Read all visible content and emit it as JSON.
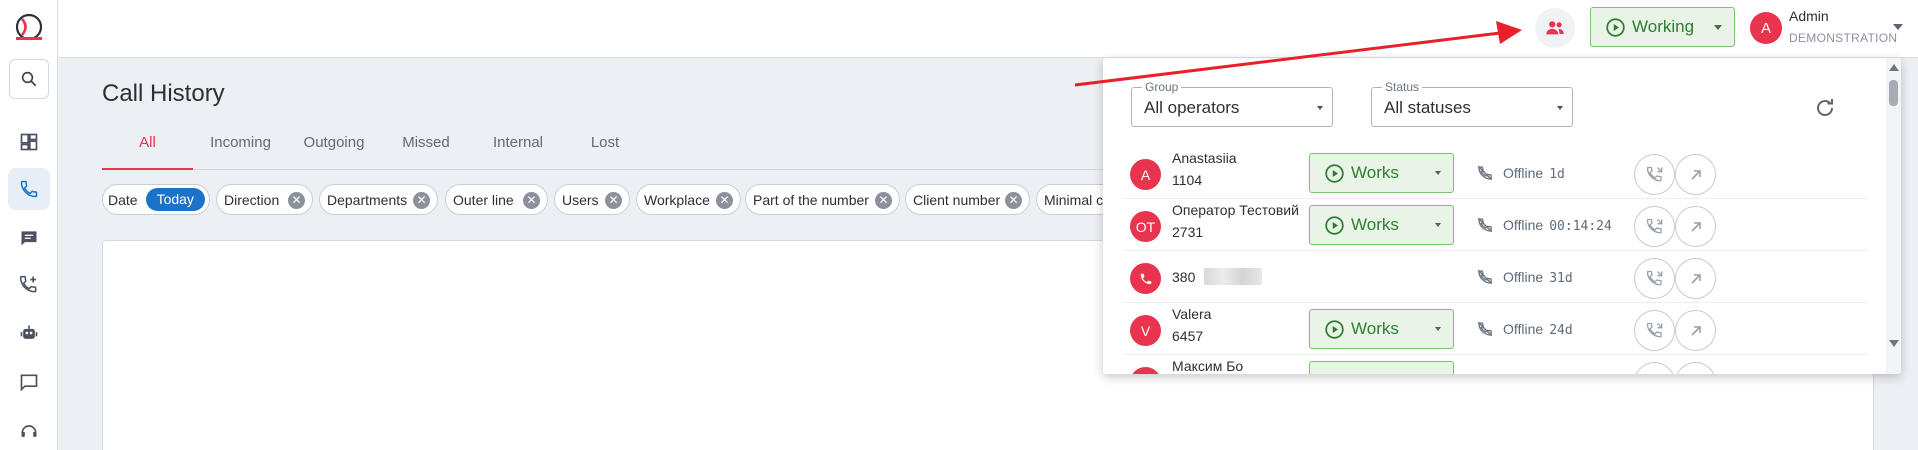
{
  "header": {
    "working_status": "Working",
    "user": {
      "initial": "A",
      "name": "Admin",
      "org": "DEMONSTRATION"
    }
  },
  "page": {
    "title": "Call History",
    "tabs": [
      "All",
      "Incoming",
      "Outgoing",
      "Missed",
      "Internal",
      "Lost"
    ],
    "filters": {
      "date_label": "Date",
      "date_value": "Today",
      "chips": [
        "Direction",
        "Departments",
        "Outer line",
        "Users",
        "Workplace",
        "Part of the number",
        "Client number",
        "Minimal ca"
      ]
    }
  },
  "operators_panel": {
    "group": {
      "label": "Group",
      "value": "All operators"
    },
    "status": {
      "label": "Status",
      "value": "All statuses"
    },
    "operators": [
      {
        "initials": "A",
        "name": "Anastasiia",
        "ext": "1104",
        "state": "Works",
        "presence": "Offline",
        "since": "1d"
      },
      {
        "initials": "OT",
        "name": "Оператор Тестовий",
        "ext": "2731",
        "state": "Works",
        "presence": "Offline",
        "since": "00:14:24"
      },
      {
        "initials": "",
        "phone": "380",
        "presence": "Offline",
        "since": "31d"
      },
      {
        "initials": "V",
        "name": "Valera",
        "ext": "6457",
        "state": "Works",
        "presence": "Offline",
        "since": "24d"
      },
      {
        "initials": "",
        "name": "Максим Бо"
      }
    ]
  },
  "colors": {
    "accent": "#e8344e",
    "primary": "#1a73c9",
    "working_bg": "#e8f4e6",
    "working_border": "#7fbf76",
    "annotation_arrow": "#e8202a"
  }
}
